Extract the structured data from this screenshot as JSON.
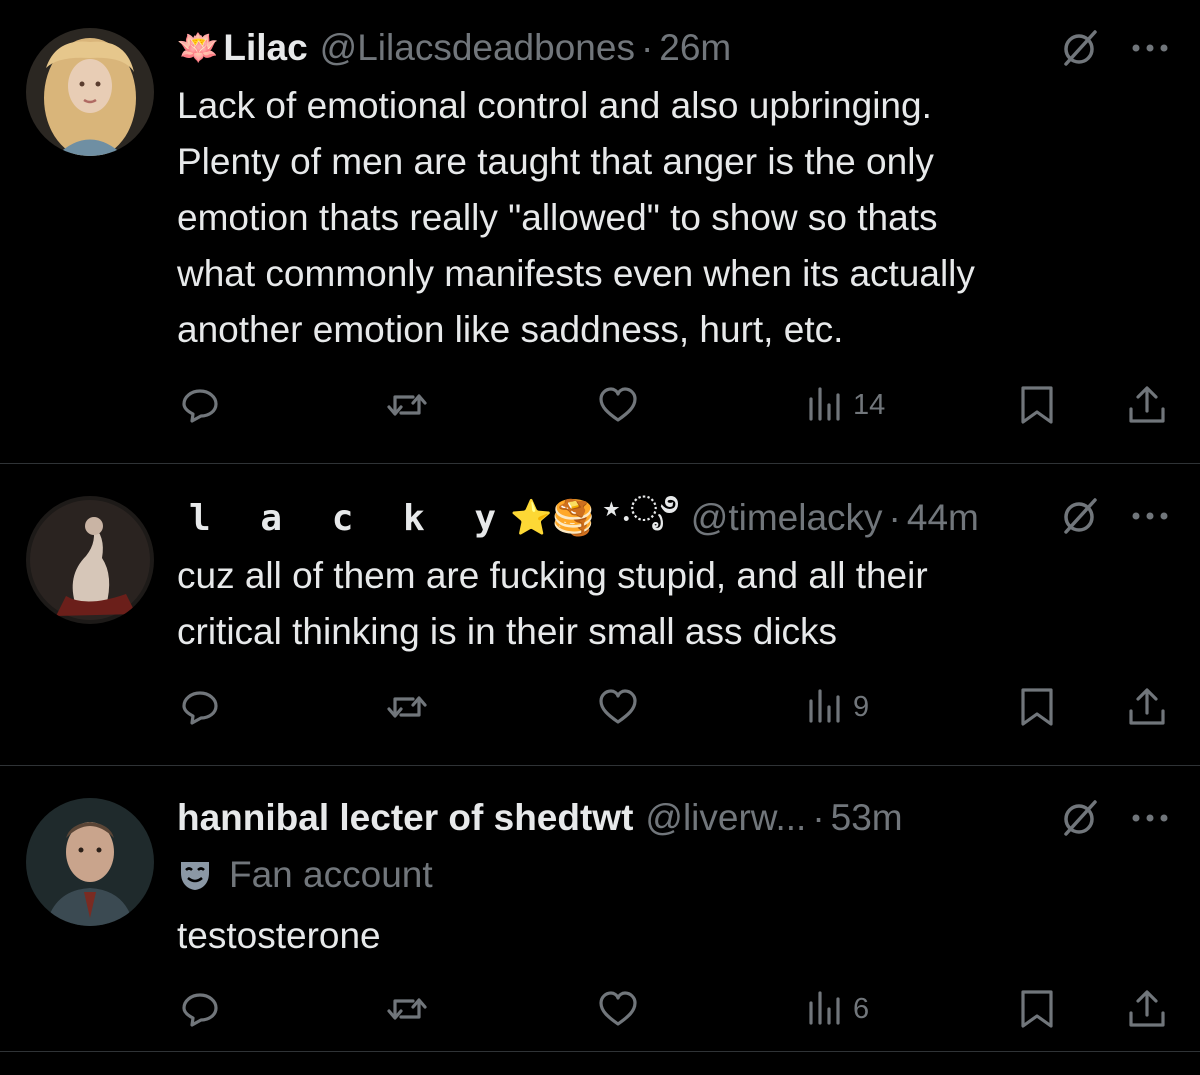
{
  "colors": {
    "background": "#000000",
    "text_primary": "#e7e9ea",
    "text_secondary": "#71767b",
    "divider": "#2f3336"
  },
  "tweets": [
    {
      "name_emoji": "🪷",
      "display_name": "Lilac",
      "handle": "@Lilacsdeadbones",
      "dot": "·",
      "time": "26m",
      "badge": "",
      "body": "Lack of emotional control and also upbringing.\nPlenty of men are taught that anger is the only\nemotion thats really \"allowed\" to show so thats\nwhat commonly manifests even when its actually\nanother emotion like saddness, hurt, etc.",
      "actions": {
        "reply_icon": "reply-icon",
        "repost_icon": "repost-icon",
        "like_icon": "heart-icon",
        "views_icon": "views-icon",
        "views_count": "14",
        "bookmark_icon": "bookmark-icon",
        "share_icon": "share-icon"
      }
    },
    {
      "display_name": "l a c k y",
      "name_emoji": "⭐🥞",
      "name_deco": "⋆.ೃ࿔",
      "handle": "@timelacky",
      "dot": "·",
      "time": "44m",
      "badge": "",
      "body": "cuz all of them are fucking stupid, and all their\ncritical thinking is in their small ass dicks",
      "actions": {
        "views_count": "9"
      }
    },
    {
      "display_name": "hannibal lecter of shedtwt",
      "handle": "@liverw...",
      "dot": "·",
      "time": "53m",
      "badge": "Fan account",
      "badge_icon": "theater-mask-icon",
      "body": "testosterone",
      "actions": {
        "views_count": "6"
      }
    }
  ],
  "icons": {
    "grok": "grok-icon",
    "more": "more-icon"
  }
}
